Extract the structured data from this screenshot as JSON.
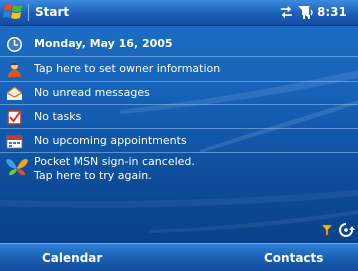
{
  "title_bar": {
    "title": "Start",
    "time": "8:31",
    "icons": [
      "connectivity-icon",
      "signal-icon",
      "volume-icon"
    ]
  },
  "today": {
    "date": "Monday, May 16, 2005",
    "owner": "Tap here to set owner information",
    "messages": "No unread messages",
    "tasks": "No tasks",
    "appointments": "No upcoming appointments",
    "msn_line1": "Pocket MSN sign-in canceled.",
    "msn_line2": "Tap here to try again."
  },
  "tray_icons": [
    "filter-icon",
    "sync-icon"
  ],
  "softkeys": {
    "left": "Calendar",
    "right": "Contacts"
  },
  "colors": {
    "background": "#1662b8",
    "title_bar": "#1c5fb9",
    "text": "#ffffff"
  }
}
